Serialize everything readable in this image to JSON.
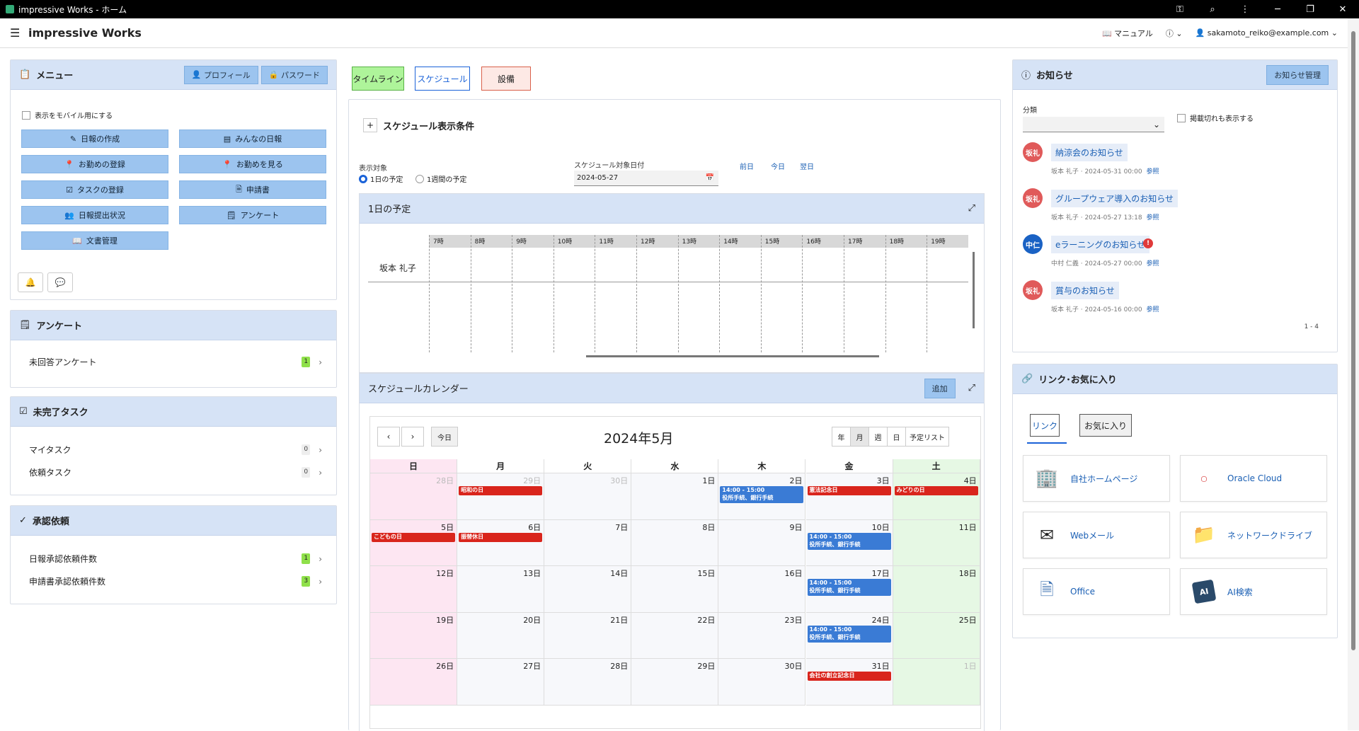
{
  "window": {
    "title": "impressive Works - ホーム"
  },
  "topbar": {
    "brand": "impressive Works",
    "manual": "マニュアル",
    "user": "sakamoto_reiko@example.com"
  },
  "menu": {
    "title": "メニュー",
    "profile_btn": "プロフィール",
    "password_btn": "パスワード",
    "mobile_label": "表示をモバイル用にする",
    "items": [
      {
        "label": "日報の作成",
        "icon": "edit-icon"
      },
      {
        "label": "みんなの日報",
        "icon": "journal-icon"
      },
      {
        "label": "お勤めの登録",
        "icon": "pin-icon"
      },
      {
        "label": "お勤めを見る",
        "icon": "pins-icon"
      },
      {
        "label": "タスクの登録",
        "icon": "checklist-icon"
      },
      {
        "label": "申請書",
        "icon": "form-icon"
      },
      {
        "label": "日報提出状況",
        "icon": "users-icon"
      },
      {
        "label": "アンケート",
        "icon": "survey-icon"
      },
      {
        "label": "文書管理",
        "icon": "book-icon"
      }
    ]
  },
  "survey": {
    "title": "アンケート",
    "rows": [
      {
        "label": "未回答アンケート",
        "count": "1"
      }
    ]
  },
  "tasks": {
    "title": "未完了タスク",
    "rows": [
      {
        "label": "マイタスク",
        "count": "0"
      },
      {
        "label": "依頼タスク",
        "count": "0"
      }
    ]
  },
  "approval": {
    "title": "承認依頼",
    "rows": [
      {
        "label": "日報承認依頼件数",
        "count": "1"
      },
      {
        "label": "申請書承認依頼件数",
        "count": "3"
      }
    ]
  },
  "tabs": {
    "timeline": "タイムライン",
    "schedule": "スケジュール",
    "facility": "設備"
  },
  "schedule": {
    "conditions": "スケジュール表示条件",
    "target_label": "表示対象",
    "opt_day": "1日の予定",
    "opt_week": "1週間の予定",
    "date_label": "スケジュール対象日付",
    "date_value": "2024-05-27",
    "prev": "前日",
    "today": "今日",
    "next": "翌日",
    "day_title": "1日の予定",
    "hours": [
      "7時",
      "8時",
      "9時",
      "10時",
      "11時",
      "12時",
      "13時",
      "14時",
      "15時",
      "16時",
      "17時",
      "18時",
      "19時"
    ],
    "person": "坂本 礼子"
  },
  "calendar": {
    "title": "スケジュールカレンダー",
    "add": "追加",
    "today": "今日",
    "month": "2024年5月",
    "views": [
      "年",
      "月",
      "週",
      "日",
      "予定リスト"
    ],
    "weekdays": [
      "日",
      "月",
      "火",
      "水",
      "木",
      "金",
      "土"
    ],
    "weeks": [
      [
        "28日",
        "29日",
        "30日",
        "1日",
        "2日",
        "3日",
        "4日"
      ],
      [
        "5日",
        "6日",
        "7日",
        "8日",
        "9日",
        "10日",
        "11日"
      ],
      [
        "12日",
        "13日",
        "14日",
        "15日",
        "16日",
        "17日",
        "18日"
      ],
      [
        "19日",
        "20日",
        "21日",
        "22日",
        "23日",
        "24日",
        "25日"
      ],
      [
        "26日",
        "27日",
        "28日",
        "29日",
        "30日",
        "31日",
        "1日"
      ]
    ],
    "events": {
      "showa": "昭和の日",
      "kenpo": "憲法記念日",
      "midori": "みどりの日",
      "kodomo": "こどもの日",
      "furikae": "振替休日",
      "souritsu": "会社の創立記念日",
      "bank_time": "14:00 - 15:00",
      "bank_title": "役所手続、銀行手続"
    }
  },
  "notices": {
    "title": "お知らせ",
    "manage": "お知らせ管理",
    "category_label": "分類",
    "expired_label": "掲載切れも表示する",
    "ref": "参照",
    "items": [
      {
        "avatar": "坂礼",
        "title": "納涼会のお知らせ",
        "meta": "坂本 礼子 · 2024-05-31 00:00"
      },
      {
        "avatar": "坂礼",
        "title": "グループウェア導入のお知らせ",
        "meta": "坂本 礼子 · 2024-05-27 13:18"
      },
      {
        "avatar": "中仁",
        "title": "eラーニングのお知らせ",
        "meta": "中村 仁義 · 2024-05-27 00:00"
      },
      {
        "avatar": "坂礼",
        "title": "賞与のお知らせ",
        "meta": "坂本 礼子 · 2024-05-16 00:00"
      }
    ],
    "paging": "1 - 4"
  },
  "links": {
    "title": "リンク･お気に入り",
    "tab_link": "リンク",
    "tab_fav": "お気に入り",
    "cards": [
      "自社ホームページ",
      "Oracle Cloud",
      "Webメール",
      "ネットワークドライブ",
      "Office",
      "AI検索"
    ]
  },
  "colors": {
    "accent": "#1a62d8",
    "header_bg": "#d6e3f6",
    "holiday_red": "#d9251c",
    "event_blue": "#3a7bd5",
    "sunday_bg": "#fde6f2",
    "saturday_bg": "#e6f8e4"
  }
}
